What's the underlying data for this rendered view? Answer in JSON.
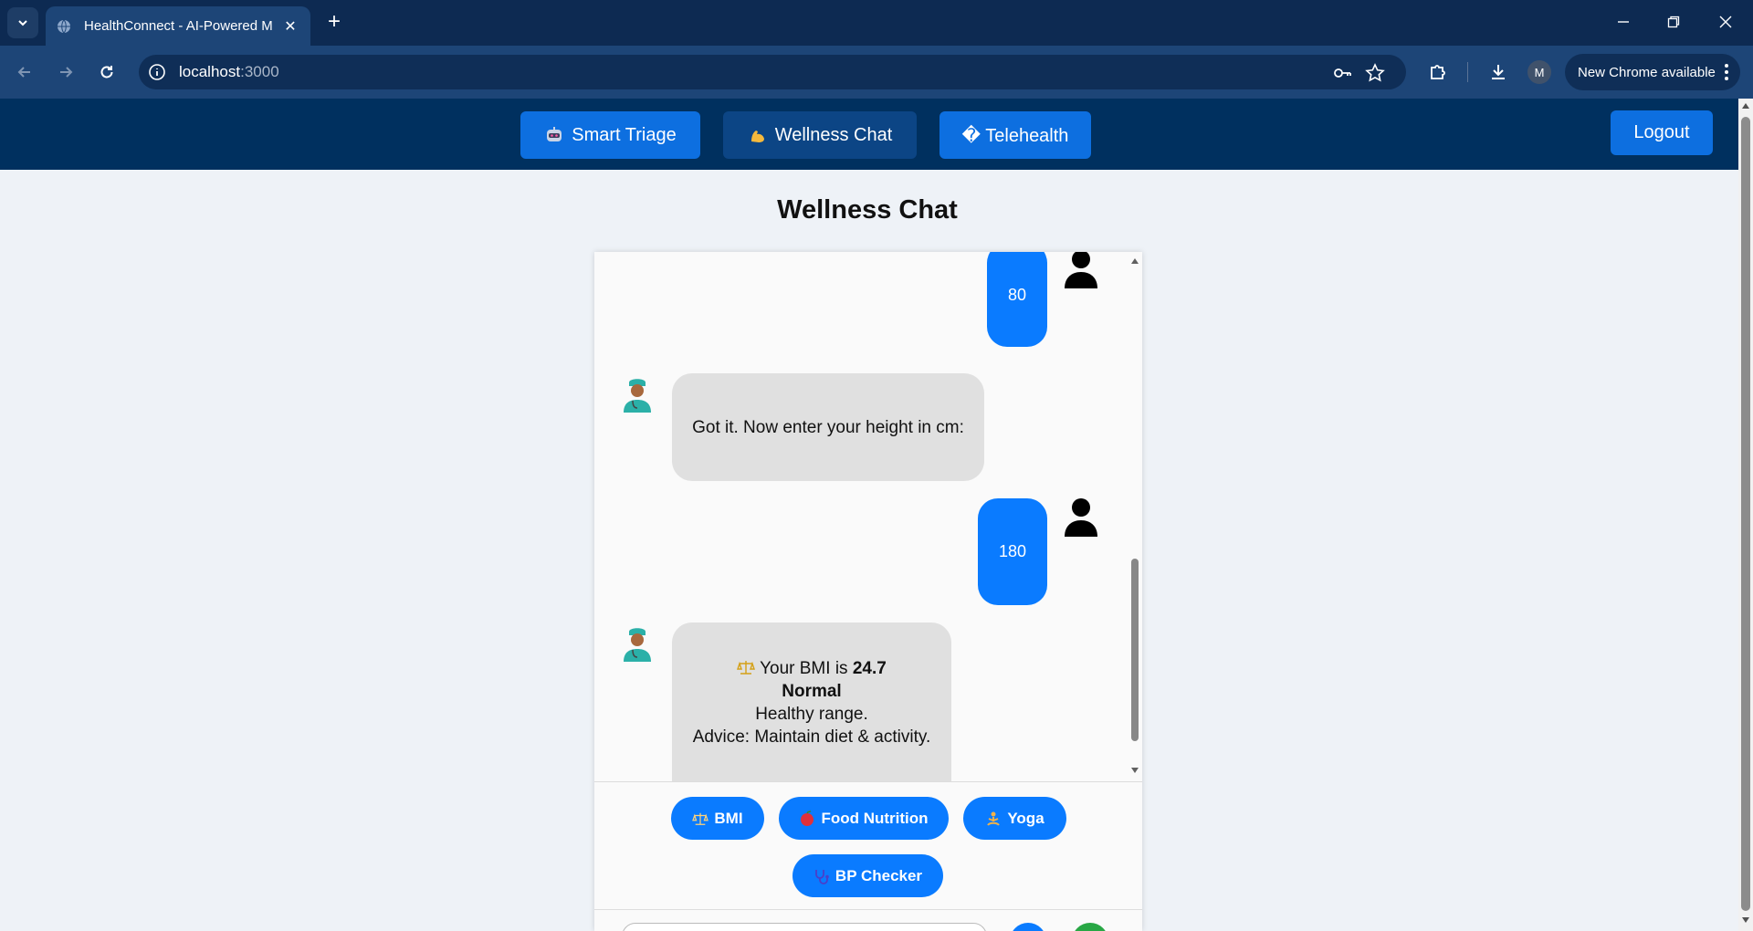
{
  "browser": {
    "tab_title": "HealthConnect - AI-Powered M",
    "url_host": "localhost",
    "url_port": ":3000",
    "avatar_letter": "M",
    "update_label": "New Chrome available"
  },
  "nav": {
    "smart_triage": "Smart Triage",
    "wellness_chat": "Wellness Chat",
    "telehealth": "� Telehealth",
    "logout": "Logout"
  },
  "page": {
    "title": "Wellness Chat"
  },
  "messages": {
    "user_weight": "80",
    "bot_height_prompt": "Got it. Now enter your height in cm:",
    "user_height": "180",
    "bot_bmi_prefix": "Your BMI is ",
    "bot_bmi_value": "24.7",
    "bot_bmi_category": "Normal",
    "bot_bmi_range": "Healthy range.",
    "bot_bmi_advice": "Advice: Maintain diet & activity."
  },
  "quick_actions": {
    "bmi": "BMI",
    "food": "Food Nutrition",
    "yoga": "Yoga",
    "bp": "BP Checker"
  },
  "colors": {
    "accent": "#0a7bff",
    "appbar": "#00305f",
    "bot_bubble": "#e0e0e0"
  }
}
